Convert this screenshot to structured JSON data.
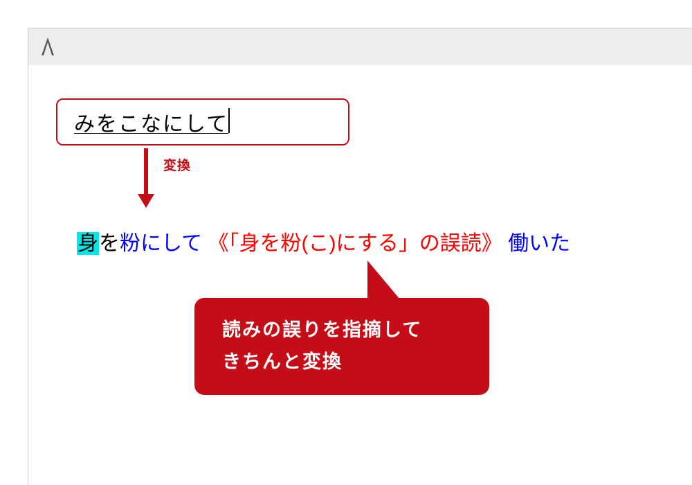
{
  "input": {
    "text": "みをこなにして"
  },
  "arrow": {
    "label": "変換"
  },
  "conversion": {
    "highlighted": "身",
    "part1": "を",
    "part2": "粉にして",
    "annotation": "《「身を粉(こ)にする」の誤読》",
    "part3": "働いた"
  },
  "callout": {
    "line1": "読みの誤りを指摘して",
    "line2": "きちんと変換"
  },
  "colors": {
    "accent": "#c40d17",
    "highlight": "#00e8e8",
    "conversion_blue": "#0000ff",
    "annotation_red": "#ff0000"
  }
}
